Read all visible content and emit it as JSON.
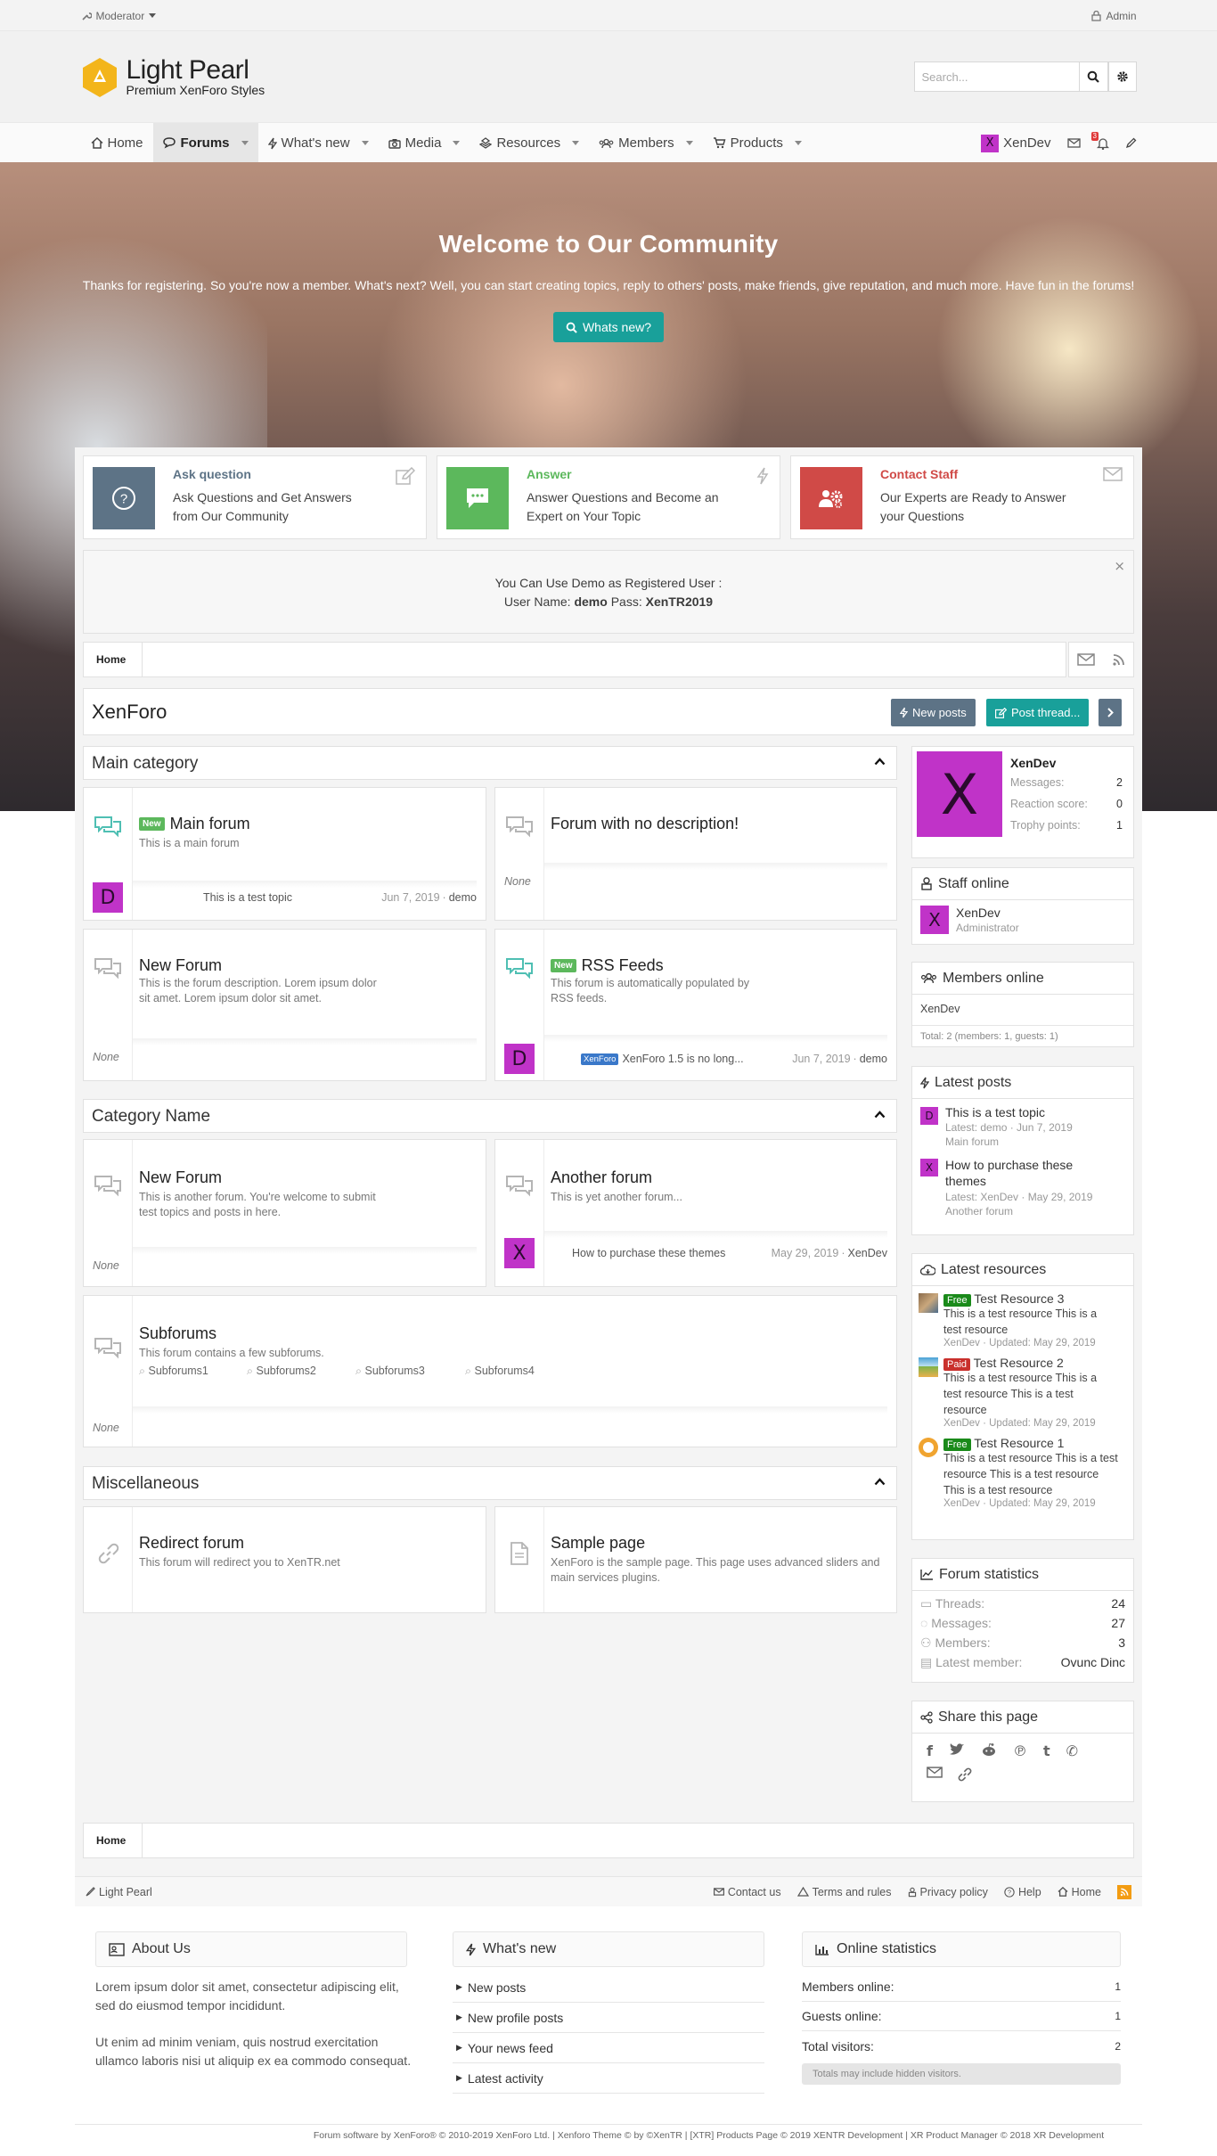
{
  "topbar": {
    "moderator": "Moderator",
    "admin": "Admin"
  },
  "brand": {
    "title": "Light Pearl",
    "tagline": "Premium XenForo Styles"
  },
  "search": {
    "placeholder": "Search..."
  },
  "nav": {
    "items": [
      "Home",
      "Forums",
      "What's new",
      "Media",
      "Resources",
      "Members",
      "Products"
    ],
    "user": "XenDev",
    "user_initial": "X",
    "alerts_count": "3"
  },
  "hero": {
    "title": "Welcome to Our Community",
    "text": "Thanks for registering. So you're now a member. What's next? Well, you can start creating topics, reply to others' posts, make friends, give reputation, and much more. Have fun in the forums!",
    "button": "Whats new?"
  },
  "features": [
    {
      "title": "Ask question",
      "desc": "Ask Questions and Get Answers from Our Community",
      "color": "#5d7386",
      "title_color": "#5d7386"
    },
    {
      "title": "Answer",
      "desc": "Answer Questions and Become an Expert on Your Topic",
      "color": "#5cb85c",
      "title_color": "#5cb85c"
    },
    {
      "title": "Contact Staff",
      "desc": "Our Experts are Ready to Answer your Questions",
      "color": "#d04a47",
      "title_color": "#d04a47"
    }
  ],
  "notice": {
    "line1": "You Can Use Demo as Registered User :",
    "user_label": "User Name:",
    "user": "demo",
    "pass_label": "Pass:",
    "pass": "XenTR2019"
  },
  "breadcrumb": {
    "home": "Home"
  },
  "page": {
    "title": "XenForo",
    "new_posts": "New posts",
    "post_thread": "Post thread..."
  },
  "categories": {
    "main": {
      "title": "Main category"
    },
    "name": {
      "title": "Category Name"
    },
    "misc": {
      "title": "Miscellaneous"
    }
  },
  "forums": {
    "main_forum": {
      "title": "Main forum",
      "badge": "New",
      "desc": "This is a main forum",
      "last_title": "This is a test topic",
      "last_date": "Jun 7, 2019",
      "last_user": "demo",
      "avatar": "D"
    },
    "no_desc": {
      "title": "Forum with no description!",
      "none": "None"
    },
    "new_forum": {
      "title": "New Forum",
      "desc": "This is the forum description. Lorem ipsum dolor sit amet. Lorem ipsum dolor sit amet.",
      "none": "None"
    },
    "rss": {
      "title": "RSS Feeds",
      "badge": "New",
      "desc": "This forum is automatically populated by RSS feeds.",
      "prefix": "XenForo",
      "last_title": "XenForo 1.5 is no long...",
      "last_date": "Jun 7, 2019",
      "last_user": "demo",
      "avatar": "D"
    },
    "new_forum2": {
      "title": "New Forum",
      "desc": "This is another forum. You're welcome to submit test topics and posts in here.",
      "none": "None"
    },
    "another": {
      "title": "Another forum",
      "desc": "This is yet another forum...",
      "last_title": "How to purchase these themes",
      "last_date": "May 29, 2019",
      "last_user": "XenDev",
      "avatar": "X"
    },
    "subforums": {
      "title": "Subforums",
      "desc": "This forum contains a few subforums.",
      "subs": [
        "Subforums1",
        "Subforums2",
        "Subforums3",
        "Subforums4"
      ],
      "none": "None"
    },
    "redirect": {
      "title": "Redirect forum",
      "desc": "This forum will redirect you to XenTR.net"
    },
    "sample": {
      "title": "Sample page",
      "desc": "XenForo is the sample page. This page uses advanced sliders and main services plugins."
    }
  },
  "profile": {
    "name": "XenDev",
    "initial": "X",
    "messages_label": "Messages:",
    "messages": "2",
    "reaction_label": "Reaction score:",
    "reaction": "0",
    "trophy_label": "Trophy points:",
    "trophy": "1"
  },
  "staff": {
    "title": "Staff online",
    "name": "XenDev",
    "role": "Administrator",
    "initial": "X"
  },
  "members_online": {
    "title": "Members online",
    "list": "XenDev",
    "total": "Total: 2 (members: 1, guests: 1)"
  },
  "latest_posts": {
    "title": "Latest posts",
    "items": [
      {
        "title": "This is a test topic",
        "meta": "Latest: demo · Jun 7, 2019",
        "forum": "Main forum",
        "initial": "D"
      },
      {
        "title": "How to purchase these themes",
        "meta": "Latest: XenDev · May 29, 2019",
        "forum": "Another forum",
        "initial": "X"
      }
    ]
  },
  "latest_resources": {
    "title": "Latest resources",
    "items": [
      {
        "badge": "Free",
        "title": "Test Resource 3",
        "desc": "This is a test resource This is a test resource",
        "meta": "XenDev · Updated: May 29, 2019",
        "badge_color": "#1a8a1a"
      },
      {
        "badge": "Paid",
        "title": "Test Resource 2",
        "desc": "This is a test resource This is a test resource This is a test resource",
        "meta": "XenDev · Updated: May 29, 2019",
        "badge_color": "#c9302c"
      },
      {
        "badge": "Free",
        "title": "Test Resource 1",
        "desc": "This is a test resource This is a test resource This is a test resource This is a test resource",
        "meta": "XenDev · Updated: May 29, 2019",
        "badge_color": "#1a8a1a"
      }
    ]
  },
  "forum_stats": {
    "title": "Forum statistics",
    "threads_label": "Threads:",
    "threads": "24",
    "messages_label": "Messages:",
    "messages": "27",
    "members_label": "Members:",
    "members": "3",
    "latest_label": "Latest member:",
    "latest": "Ovunc Dinc"
  },
  "share": {
    "title": "Share this page"
  },
  "footer": {
    "style": "Light Pearl",
    "links": [
      "Contact us",
      "Terms and rules",
      "Privacy policy",
      "Help",
      "Home"
    ],
    "about": {
      "title": "About Us",
      "p1": "Lorem ipsum dolor sit amet, consectetur adipiscing elit, sed do eiusmod tempor incididunt.",
      "p2": "Ut enim ad minim veniam, quis nostrud exercitation ullamco laboris nisi ut aliquip ex ea commodo consequat."
    },
    "whatsnew": {
      "title": "What's new",
      "items": [
        "New posts",
        "New profile posts",
        "Your news feed",
        "Latest activity"
      ]
    },
    "stats": {
      "title": "Online statistics",
      "members_label": "Members online:",
      "members": "1",
      "guests_label": "Guests online:",
      "guests": "1",
      "total_label": "Total visitors:",
      "total": "2",
      "note": "Totals may include hidden visitors."
    },
    "copyright": "Forum software by XenForo® © 2010-2019 XenForo Ltd. | Xenforo Theme © by ©XenTR | [XTR] Products Page © 2019 XENTR Development | XR Product Manager © 2018 XR Development"
  }
}
